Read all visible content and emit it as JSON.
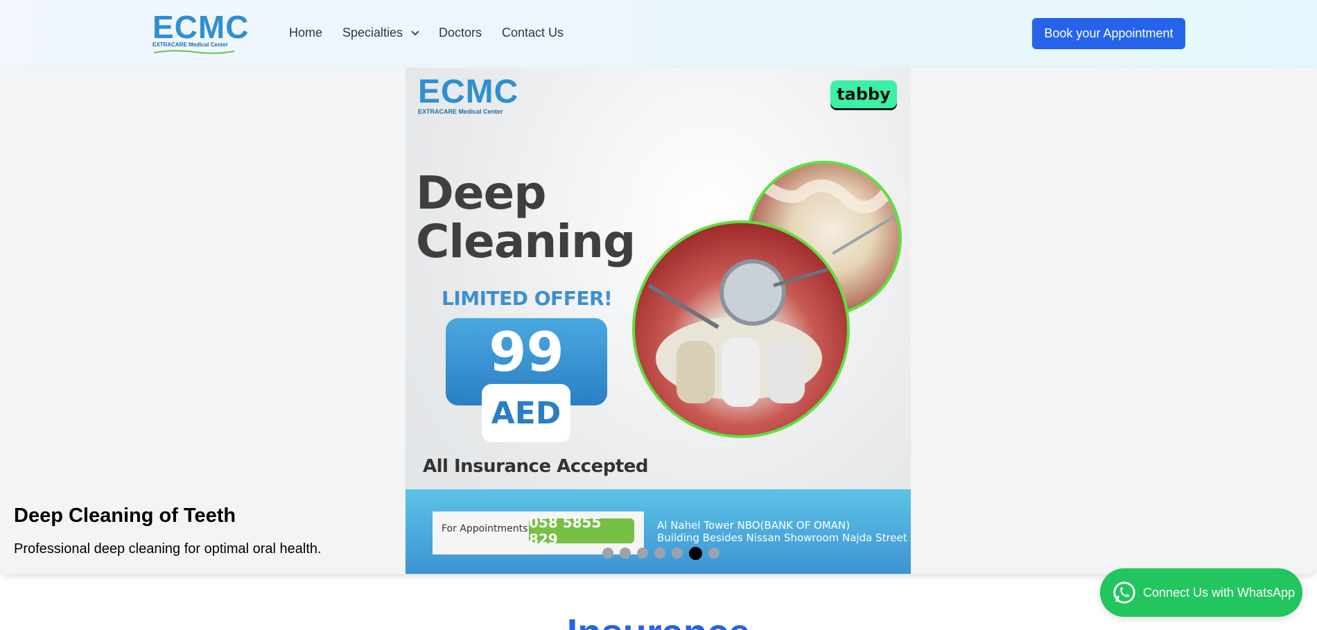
{
  "header": {
    "logo": {
      "mark": "ECMC",
      "name": "EXTRACARE Medical Center"
    },
    "nav": [
      {
        "label": "Home"
      },
      {
        "label": "Specialties"
      },
      {
        "label": "Doctors"
      },
      {
        "label": "Contact Us"
      }
    ],
    "cta_label": "Book your Appointment"
  },
  "hero": {
    "banner": {
      "logo_mark": "ECMC",
      "logo_name": "EXTRACARE Medical Center",
      "tabby": "tabby",
      "headline_line1": "Deep",
      "headline_line2": "Cleaning",
      "limited_offer": "LIMITED OFFER!",
      "price": "99",
      "currency": "AED",
      "insurance": "All Insurance Accepted",
      "appointments_label": "For Appointments",
      "phone": "058 5855 829",
      "address_line1": "Al Nahel Tower NBO(BANK OF OMAN)",
      "address_line2": "Building Besides Nissan Showroom Najda Street"
    },
    "caption_title": "Deep Cleaning of Teeth",
    "caption_desc": "Professional deep cleaning for optimal oral health.",
    "carousel": {
      "total": 7,
      "active_index": 5
    }
  },
  "whatsapp_label": "Connect Us with WhatsApp",
  "next_section_title": "Insurance",
  "colors": {
    "primary": "#2563eb",
    "whatsapp": "#22c55e",
    "hero_bg": "#f3f4f6"
  }
}
